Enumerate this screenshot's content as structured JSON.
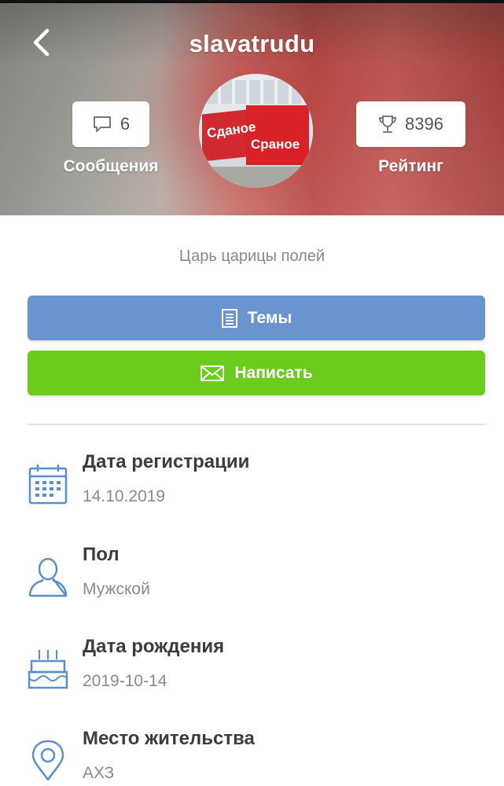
{
  "header": {
    "username": "slavatrudu",
    "messages": {
      "count": "6",
      "label": "Сообщения"
    },
    "rating": {
      "count": "8396",
      "label": "Рейтинг"
    },
    "avatar": {
      "sign_text_1": "Сданое",
      "sign_text_2": "Сраное"
    }
  },
  "profile": {
    "status": "Царь царицы полей",
    "topics_label": "Темы",
    "write_label": "Написать"
  },
  "info": [
    {
      "title": "Дата регистрации",
      "value": "14.10.2019",
      "icon": "calendar-icon"
    },
    {
      "title": "Пол",
      "value": "Мужской",
      "icon": "user-icon"
    },
    {
      "title": "Дата рождения",
      "value": "2019-10-14",
      "icon": "cake-icon"
    },
    {
      "title": "Место жительства",
      "value": "АХЗ",
      "icon": "location-pin-icon"
    }
  ],
  "colors": {
    "accent_blue": "#6a94cf",
    "accent_green": "#6ccc1c",
    "icon_blue": "#5b8ed0",
    "text_dark": "#3c3c3c",
    "text_muted": "#8a8a8a"
  }
}
